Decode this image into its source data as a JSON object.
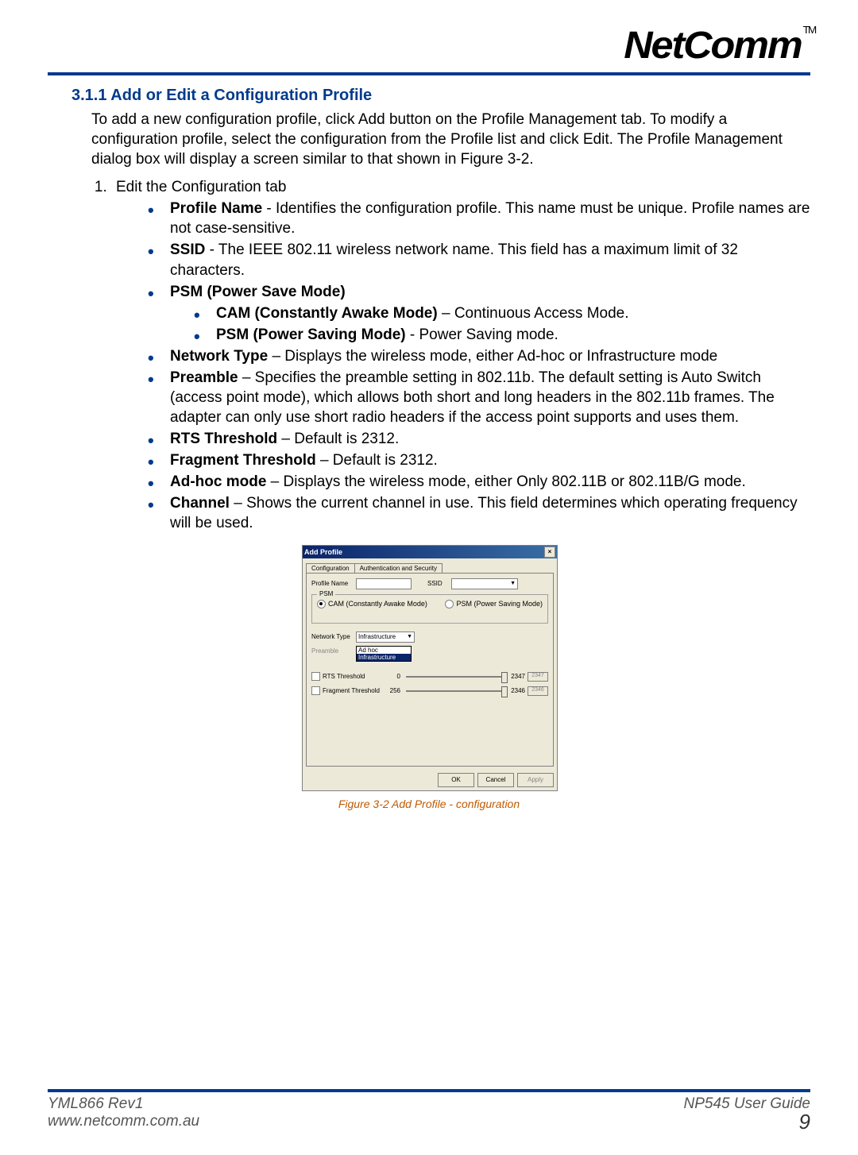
{
  "header": {
    "logo_text": "NetComm",
    "tm": "TM"
  },
  "section_title": "3.1.1 Add or Edit a Configuration Profile",
  "intro": "To add a new configuration profile, click Add button on the Profile Management tab. To modify a configuration profile, select the configuration from the Profile list and click Edit. The Profile Management dialog box will display a screen similar to that shown in Figure 3-2.",
  "step1": "Edit the Configuration tab",
  "bullets": {
    "profile_name": {
      "b": "Profile Name",
      "t": " - Identifies the configuration profile. This name must be unique. Profile names are not case-sensitive."
    },
    "ssid": {
      "b": "SSID",
      "t": " - The IEEE 802.11 wireless network name. This field has a maximum limit of 32 characters."
    },
    "psm_head": "PSM (Power Save Mode)",
    "cam": {
      "b": "CAM (Constantly Awake Mode)",
      "t": " – Continuous Access Mode."
    },
    "psm": {
      "b": "PSM (Power Saving Mode)",
      "t": " - Power Saving mode."
    },
    "network_type": {
      "b": "Network Type",
      "t": " – Displays the wireless mode, either Ad-hoc or Infrastructure mode"
    },
    "preamble": {
      "b": "Preamble",
      "t": " – Specifies the preamble setting in 802.11b. The default setting is Auto Switch (access point mode), which allows both short and long headers in the 802.11b frames. The adapter can only use short radio headers if the access point supports and uses them."
    },
    "rts": {
      "b": "RTS Threshold",
      "t": " – Default is 2312."
    },
    "frag": {
      "b": "Fragment Threshold",
      "t": " – Default is 2312."
    },
    "adhoc": {
      "b": "Ad-hoc mode",
      "t": " – Displays the wireless mode, either Only 802.11B or 802.11B/G mode."
    },
    "channel": {
      "b": "Channel",
      "t": " – Shows the current channel in use. This field determines which operating frequency will be used."
    }
  },
  "dialog": {
    "title": "Add Profile",
    "tab1": "Configuration",
    "tab2": "Authentication and Security",
    "profile_name_lbl": "Profile Name",
    "ssid_lbl": "SSID",
    "psm_legend": "PSM",
    "cam_lbl": "CAM (Constantly Awake Mode)",
    "psm_lbl": "PSM (Power Saving Mode)",
    "network_type_lbl": "Network Type",
    "network_type_val": "Infrastructure",
    "preamble_lbl": "Preamble",
    "dd_adhoc": "Ad hoc",
    "dd_infra": "Infrastructure",
    "rts_lbl": "RTS Threshold",
    "rts_min": "0",
    "rts_max": "2347",
    "rts_val": "2347",
    "frag_lbl": "Fragment Threshold",
    "frag_min": "256",
    "frag_max": "2346",
    "frag_val": "2346",
    "ok": "OK",
    "cancel": "Cancel",
    "apply": "Apply"
  },
  "caption": "Figure 3-2 Add Profile - configuration",
  "footer": {
    "left1": "YML866 Rev1",
    "left2": "www.netcomm.com.au",
    "right1": "NP545 User Guide",
    "page": "9"
  }
}
